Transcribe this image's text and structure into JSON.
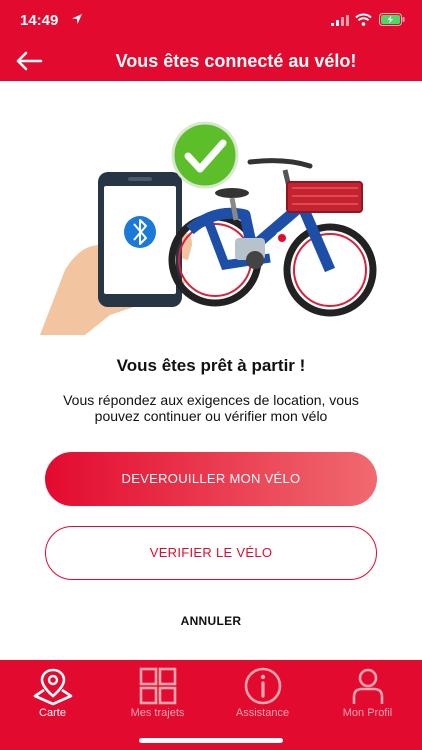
{
  "status_bar": {
    "time": "14:49"
  },
  "header": {
    "title": "Vous êtes connecté au vélo!"
  },
  "main": {
    "headline": "Vous êtes prêt à partir !",
    "description": "Vous répondez aux exigences de location, vous pouvez continuer ou vérifier mon vélo",
    "unlock_label": "DEVEROUILLER MON VÉLO",
    "check_label": "VERIFIER LE VÉLO",
    "cancel_label": "ANNULER"
  },
  "tabbar": {
    "items": [
      {
        "label": "Carte",
        "icon": "map-pin-icon",
        "active": true
      },
      {
        "label": "Mes trajets",
        "icon": "grid-icon",
        "active": false
      },
      {
        "label": "Assistance",
        "icon": "info-icon",
        "active": false
      },
      {
        "label": "Mon Profil",
        "icon": "user-icon",
        "active": false
      }
    ]
  },
  "colors": {
    "brand": "#e30a2f",
    "check_green": "#5cbf2a",
    "bike_blue": "#1d4fa8",
    "bluetooth": "#1a7ad8"
  }
}
